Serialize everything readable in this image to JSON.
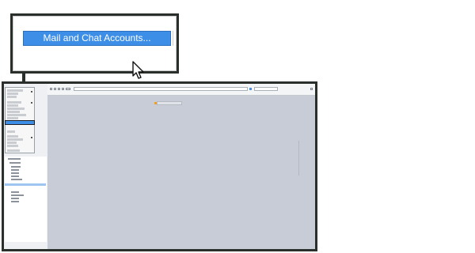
{
  "callout": {
    "menu_item_label": "Mail and Chat Accounts..."
  },
  "icons": {
    "cursor": "mouse-pointer-arrow-icon",
    "submenu_arrow": "chevron-right-icon",
    "folder": "folder-icon"
  },
  "colors": {
    "highlight": "#3d8ee6",
    "frame": "#2a2f2b",
    "content_bg": "#c8ccd6",
    "sidebar_bg": "#eef0f4"
  }
}
